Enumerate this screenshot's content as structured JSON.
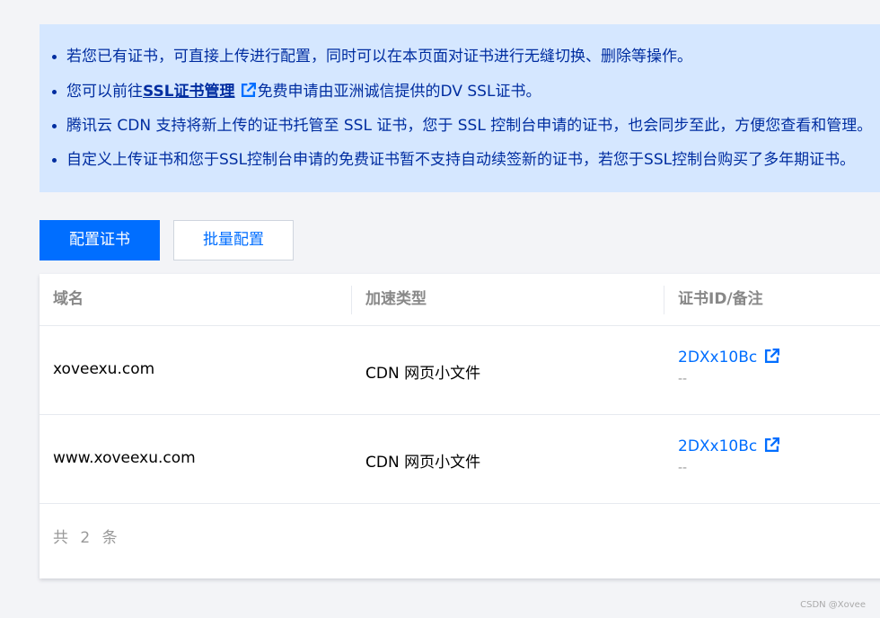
{
  "notice": {
    "items": [
      {
        "text": "若您已有证书，可直接上传进行配置，同时可以在本页面对证书进行无缝切换、删除等操作。"
      },
      {
        "prefix": "您可以前往",
        "link": "SSL证书管理",
        "suffix": "免费申请由亚洲诚信提供的DV SSL证书。"
      },
      {
        "text": "腾讯云 CDN 支持将新上传的证书托管至 SSL 证书，您于 SSL 控制台申请的证书，也会同步至此，方便您查看和管理。"
      },
      {
        "text": "自定义上传证书和您于SSL控制台申请的免费证书暂不支持自动续签新的证书，若您于SSL控制台购买了多年期证书。"
      }
    ],
    "colors": {
      "background": "#d5e7ff",
      "text": "#002da0"
    }
  },
  "toolbar": {
    "configure_label": "配置证书",
    "batch_label": "批量配置"
  },
  "table": {
    "headers": [
      "域名",
      "加速类型",
      "证书ID/备注"
    ],
    "rows": [
      {
        "domain": "xoveexu.com",
        "type": "CDN 网页小文件",
        "cert_id": "2DXx10Bc",
        "note": "--"
      },
      {
        "domain": "www.xoveexu.com",
        "type": "CDN 网页小文件",
        "cert_id": "2DXx10Bc",
        "note": "--"
      }
    ],
    "total_text": "共 2 条"
  },
  "watermark": "CSDN @Xovee",
  "colors": {
    "accent": "#006eff",
    "page_bg": "#f3f4f7"
  }
}
